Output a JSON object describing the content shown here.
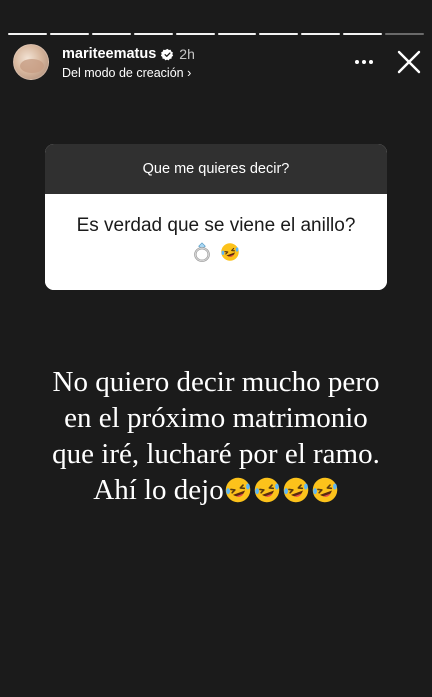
{
  "header": {
    "username": "mariteematus",
    "time": "2h",
    "subtitle": "Del modo de creación ›",
    "verified": true
  },
  "progress": {
    "segments": 10,
    "completed": 9
  },
  "question": {
    "prompt": "Que me quieres decir?",
    "answer": "Es verdad que se viene el anillo?",
    "answer_emojis": [
      "ring-emoji",
      "rolling-laughing-emoji"
    ]
  },
  "caption": {
    "line1": "No quiero decir mucho pero",
    "line2": "en el próximo matrimonio",
    "line3": "que iré, lucharé por el ramo.",
    "line4": "Ahí lo dejo",
    "trailing_emoji_count": 4,
    "trailing_emoji": "rolling-laughing-emoji"
  },
  "colors": {
    "background": "#1b1b1b",
    "question_header": "#303030",
    "question_body": "#ffffff",
    "verified_blue": "#3897f0"
  }
}
